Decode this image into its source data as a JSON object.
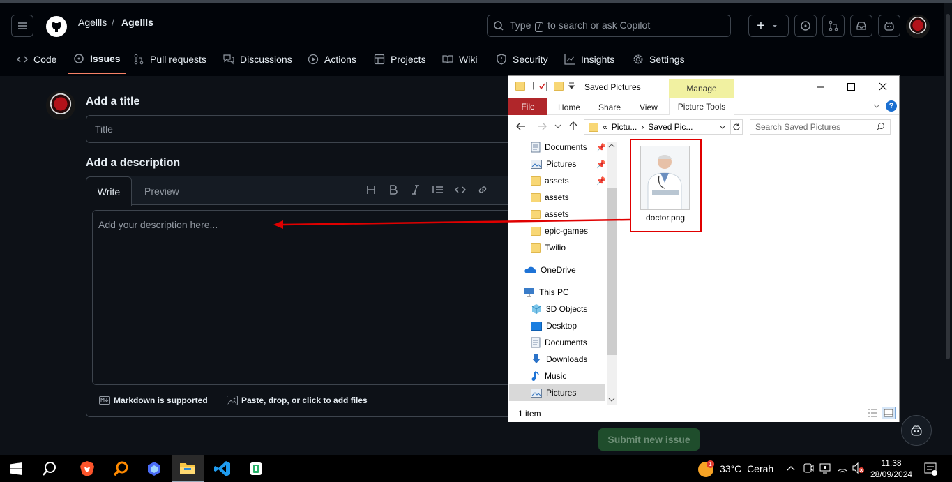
{
  "header": {
    "owner": "Agellls",
    "separator": "/",
    "repo": "Agellls",
    "search_prefix": "Type",
    "search_key": "/",
    "search_suffix": "to search or ask Copilot",
    "plus_label": "+"
  },
  "tabs": [
    {
      "label": "Code",
      "icon": "code-icon"
    },
    {
      "label": "Issues",
      "icon": "issue-icon",
      "selected": true
    },
    {
      "label": "Pull requests",
      "icon": "pull-request-icon"
    },
    {
      "label": "Discussions",
      "icon": "discussion-icon"
    },
    {
      "label": "Actions",
      "icon": "play-icon"
    },
    {
      "label": "Projects",
      "icon": "table-icon"
    },
    {
      "label": "Wiki",
      "icon": "book-icon"
    },
    {
      "label": "Security",
      "icon": "shield-icon"
    },
    {
      "label": "Insights",
      "icon": "graph-icon"
    },
    {
      "label": "Settings",
      "icon": "gear-icon"
    }
  ],
  "issue_form": {
    "title_label": "Add a title",
    "title_placeholder": "Title",
    "description_label": "Add a description",
    "tab_write": "Write",
    "tab_preview": "Preview",
    "description_placeholder": "Add your description here...",
    "markdown_note": "Markdown is supported",
    "attach_note": "Paste, drop, or click to add files",
    "submit_label": "Submit new issue"
  },
  "explorer": {
    "window_title": "Saved Pictures",
    "manage_label": "Manage",
    "ribbon_tabs": [
      "File",
      "Home",
      "Share",
      "View",
      "Picture Tools"
    ],
    "address_parts": [
      "«",
      "Pictu...",
      "›",
      "Saved Pic..."
    ],
    "search_placeholder": "Search Saved Pictures",
    "nav": [
      {
        "label": "Documents",
        "pinned": true
      },
      {
        "label": "Pictures",
        "pinned": true
      },
      {
        "label": "assets",
        "pinned": true
      },
      {
        "label": "assets"
      },
      {
        "label": "assets"
      },
      {
        "label": "epic-games"
      },
      {
        "label": "Twilio"
      },
      {
        "label": "OneDrive"
      },
      {
        "label": "This PC"
      },
      {
        "label": "3D Objects"
      },
      {
        "label": "Desktop"
      },
      {
        "label": "Documents"
      },
      {
        "label": "Downloads"
      },
      {
        "label": "Music"
      },
      {
        "label": "Pictures",
        "selected": true
      }
    ],
    "file_name": "doctor.png",
    "status": "1 item"
  },
  "taskbar": {
    "temperature": "33°C",
    "condition": "Cerah",
    "time": "11:38",
    "date": "28/09/2024",
    "weather_badge": "1"
  },
  "colors": {
    "accent_tab": "#f78166",
    "submit_bg": "#1f4d2c",
    "file_tab": "#b0262a",
    "manage_bg": "#f1f1a1",
    "highlight_red": "#e00000"
  }
}
